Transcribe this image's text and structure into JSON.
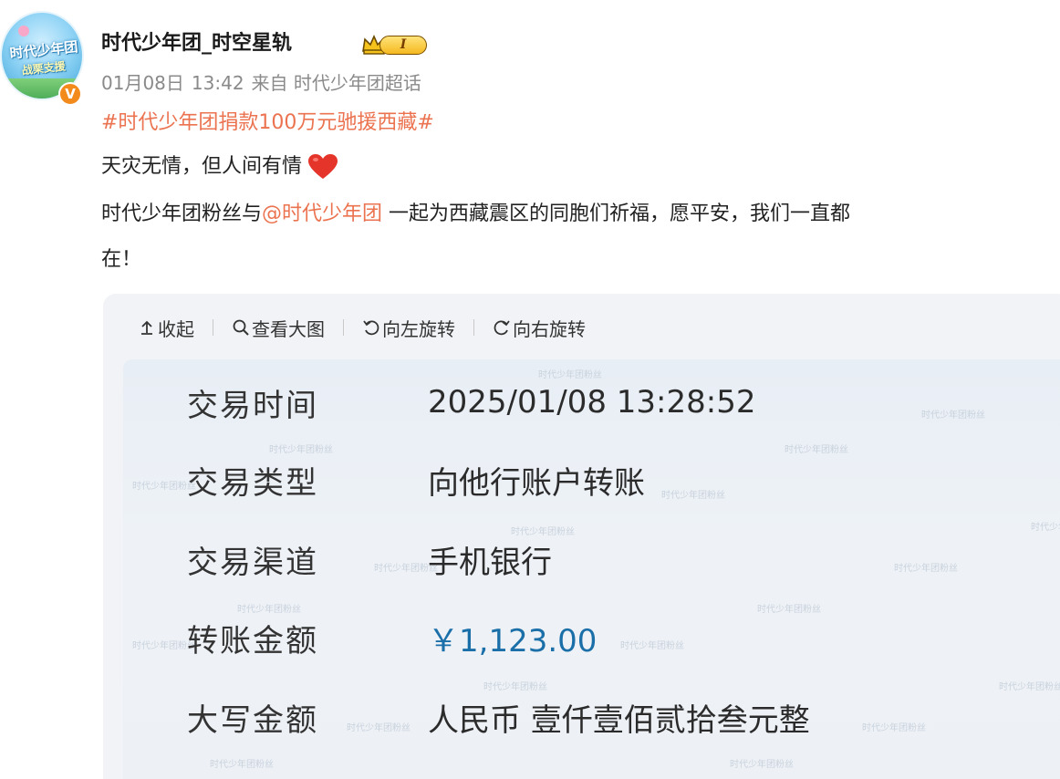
{
  "post": {
    "username": "时代少年团_时空星轨",
    "level_badge": "I",
    "avatar_text_line1": "时代少年团",
    "avatar_text_line2": "战栗支援",
    "verified_badge": "V",
    "date": "01月08日",
    "time": "13:42",
    "source": "来自 时代少年团超话",
    "topic": "#时代少年团捐款100万元驰援西藏#",
    "line2": "天灾无情，但人间有情",
    "line3_prefix": "时代少年团粉丝与",
    "mention": "@时代少年团",
    "line3_suffix": " 一起为西藏震区的同胞们祈福，愿平安，我们一直都",
    "line4": "在！"
  },
  "toolbar": {
    "collapse_label": "收起",
    "view_large_label": "查看大图",
    "rotate_left_label": "向左旋转",
    "rotate_right_label": "向右旋转"
  },
  "receipt": {
    "watermark_text": "时代少年团粉丝",
    "rows": [
      {
        "label": "交易时间",
        "value": "2025/01/08 13:28:52"
      },
      {
        "label": "交易类型",
        "value": "向他行账户转账"
      },
      {
        "label": "交易渠道",
        "value": "手机银行"
      },
      {
        "label": "转账金额",
        "value": "￥1,123.00"
      },
      {
        "label": "大写金额",
        "value": "人民币 壹仟壹佰贰拾叁元整"
      }
    ]
  },
  "colors": {
    "topic": "#eb7350",
    "amount": "#1b6fa8",
    "meta": "#8a8a8a",
    "panel_bg": "#f1f3f6"
  }
}
